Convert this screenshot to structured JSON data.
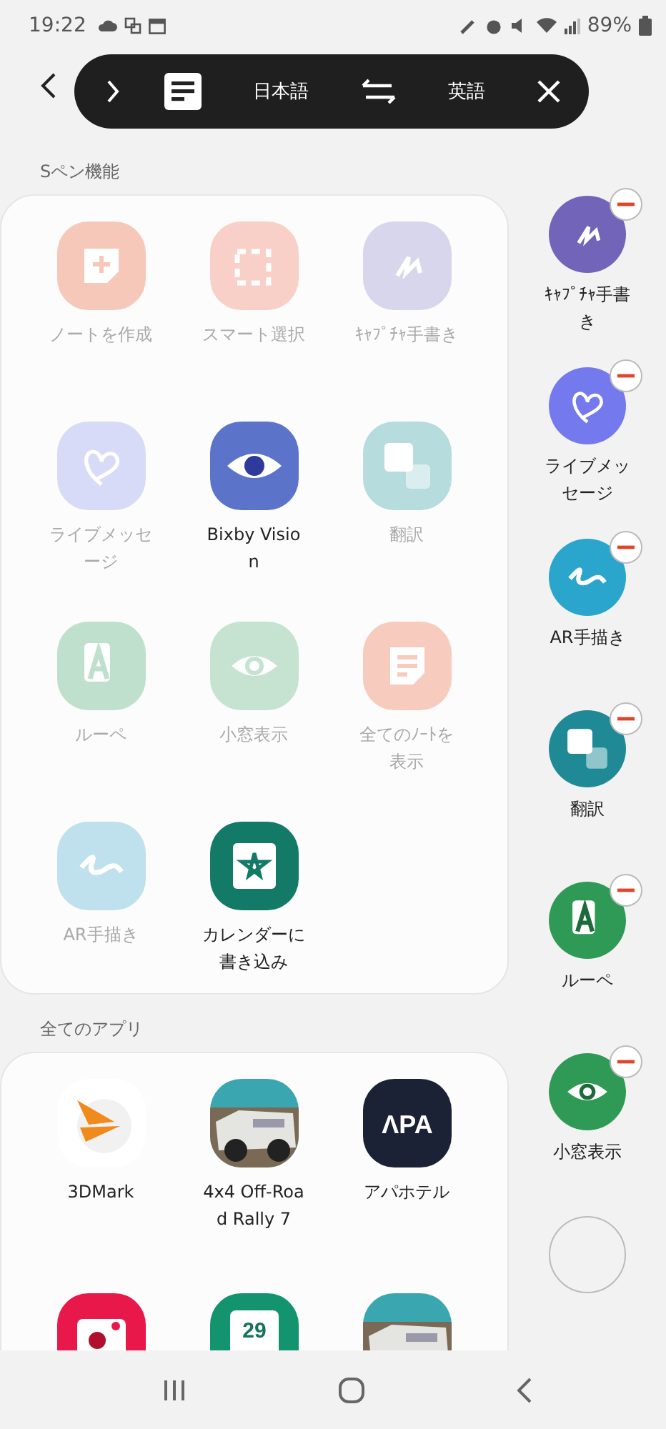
{
  "status_bar": {
    "time": "19:22",
    "battery": "89%"
  },
  "translate_bar": {
    "source": "日本語",
    "target": "英語"
  },
  "spen_section": {
    "title": "Sペン機能",
    "items": [
      {
        "label": "ノートを作成",
        "kind": "note",
        "color": "#f5c8ba",
        "disabled": true
      },
      {
        "label": "スマート選択",
        "kind": "select",
        "color": "#f9d0c8",
        "disabled": true
      },
      {
        "label": "ｷｬﾌﾟﾁｬ手書き",
        "kind": "capture",
        "color": "#d8d6ec",
        "disabled": true
      },
      {
        "label": "ライブメッセージ",
        "kind": "heart",
        "color": "#d8dbf8",
        "disabled": true
      },
      {
        "label": "Bixby Vision",
        "kind": "bixby",
        "color": "#5b74c9",
        "disabled": false
      },
      {
        "label": "翻訳",
        "kind": "translate",
        "color": "#b6dcde",
        "disabled": true
      },
      {
        "label": "ルーペ",
        "kind": "loupe",
        "color": "#bfe0cc",
        "disabled": true
      },
      {
        "label": "小窓表示",
        "kind": "eye",
        "color": "#c5e3d0",
        "disabled": true
      },
      {
        "label": "全てのﾉｰﾄを表示",
        "kind": "notes",
        "color": "#f7ccbe",
        "disabled": true
      },
      {
        "label": "AR手描き",
        "kind": "ar",
        "color": "#bfe1ed",
        "disabled": true
      },
      {
        "label": "カレンダーに書き込み",
        "kind": "calendar",
        "color": "#137a68",
        "disabled": false
      }
    ]
  },
  "apps_section": {
    "title": "全てのアプリ",
    "items": [
      {
        "label": "3DMark",
        "kind": "logo"
      },
      {
        "label": "4x4 Off-Road Rally 7",
        "kind": "picture"
      },
      {
        "label": "アパホテル",
        "kind": "wordmark",
        "logo_text": "ΛPA"
      },
      {
        "kind": "camera"
      },
      {
        "kind": "calendar",
        "logo_text": "29"
      },
      {
        "kind": "picture"
      }
    ]
  },
  "shortcuts": [
    {
      "label": "ｷｬﾌﾟﾁｬ手書き",
      "kind": "capture",
      "color": "#7264b8"
    },
    {
      "label": "ライブメッセージ",
      "kind": "heart",
      "color": "#7479ee"
    },
    {
      "label": "AR手描き",
      "kind": "ar",
      "color": "#2aa6cc"
    },
    {
      "label": "翻訳",
      "kind": "translate",
      "color": "#1f8a96"
    },
    {
      "label": "ルーペ",
      "kind": "loupe",
      "color": "#2f9a55"
    },
    {
      "label": "小窓表示",
      "kind": "eye",
      "color": "#2f9a55"
    }
  ]
}
